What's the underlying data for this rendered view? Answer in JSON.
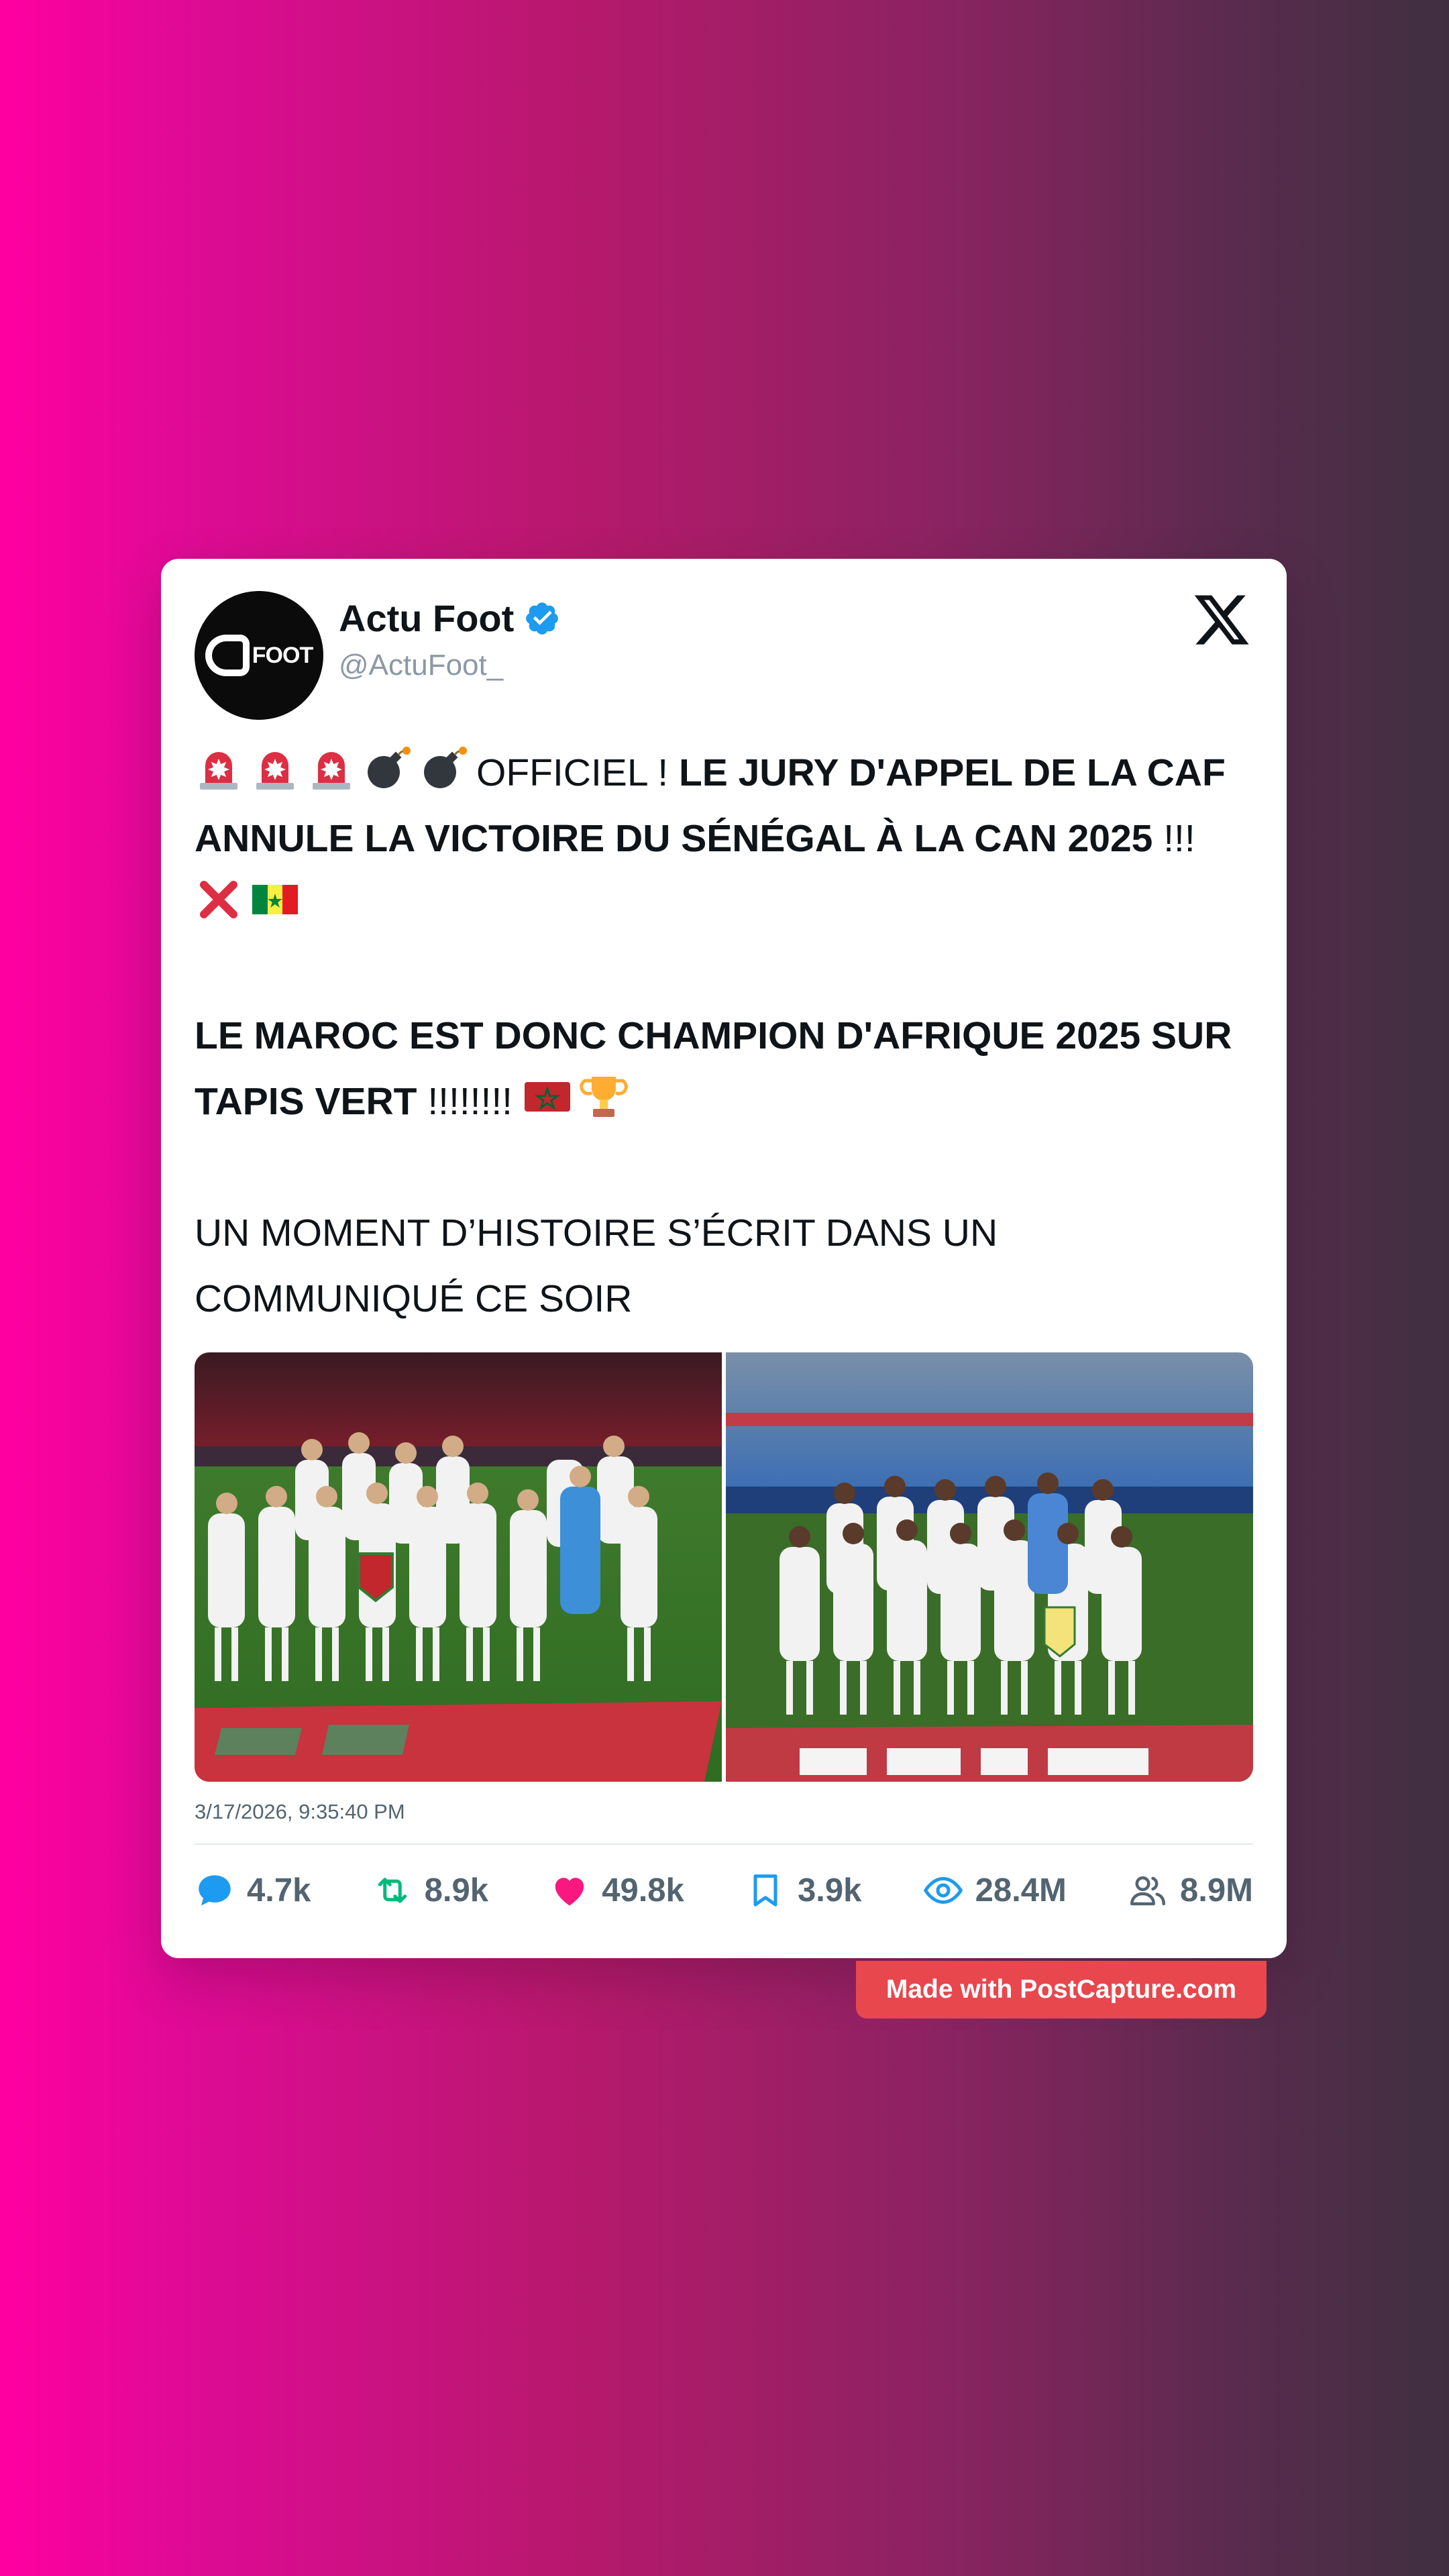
{
  "author": {
    "display_name": "Actu Foot",
    "handle": "@ActuFoot_",
    "avatar_text": "FOOT",
    "verified": true
  },
  "tweet": {
    "line1_plain": "OFFICIEL !",
    "line1_bold": "LE JURY D'APPEL DE LA CAF ANNULE LA VICTOIRE DU SÉNÉGAL À LA CAN 2025",
    "line1_tail": "!!!",
    "para2_bold": "LE MAROC EST DONC CHAMPION D'AFRIQUE 2025 SUR TAPIS VERT",
    "para2_tail": "!!!!!!!!",
    "para3": "UN MOMENT D’HISTOIRE S’ÉCRIT DANS UN COMMUNIQUÉ CE SOIR",
    "emojis_leading": [
      "police-light-icon",
      "police-light-icon",
      "police-light-icon",
      "bomb-icon",
      "bomb-icon"
    ],
    "emojis_line1_end": [
      "cross-mark-icon",
      "flag-senegal-icon"
    ],
    "emojis_para2_end": [
      "flag-morocco-icon",
      "trophy-icon"
    ]
  },
  "media": {
    "left_photo": "morocco-team-photo",
    "right_photo": "senegal-team-photo"
  },
  "timestamp": "3/17/2026, 9:35:40 PM",
  "stats": {
    "replies": "4.7k",
    "retweets": "8.9k",
    "likes": "49.8k",
    "bookmarks": "3.9k",
    "views": "28.4M",
    "followers": "8.9M"
  },
  "watermark": "Made with PostCapture.com",
  "colors": {
    "reply": "#1d9bf0",
    "retweet": "#00ba7c",
    "like": "#f91880",
    "bookmark": "#1d9bf0",
    "view": "#1d9bf0",
    "followers": "#536471",
    "watermark_bg": "#e8474e"
  }
}
